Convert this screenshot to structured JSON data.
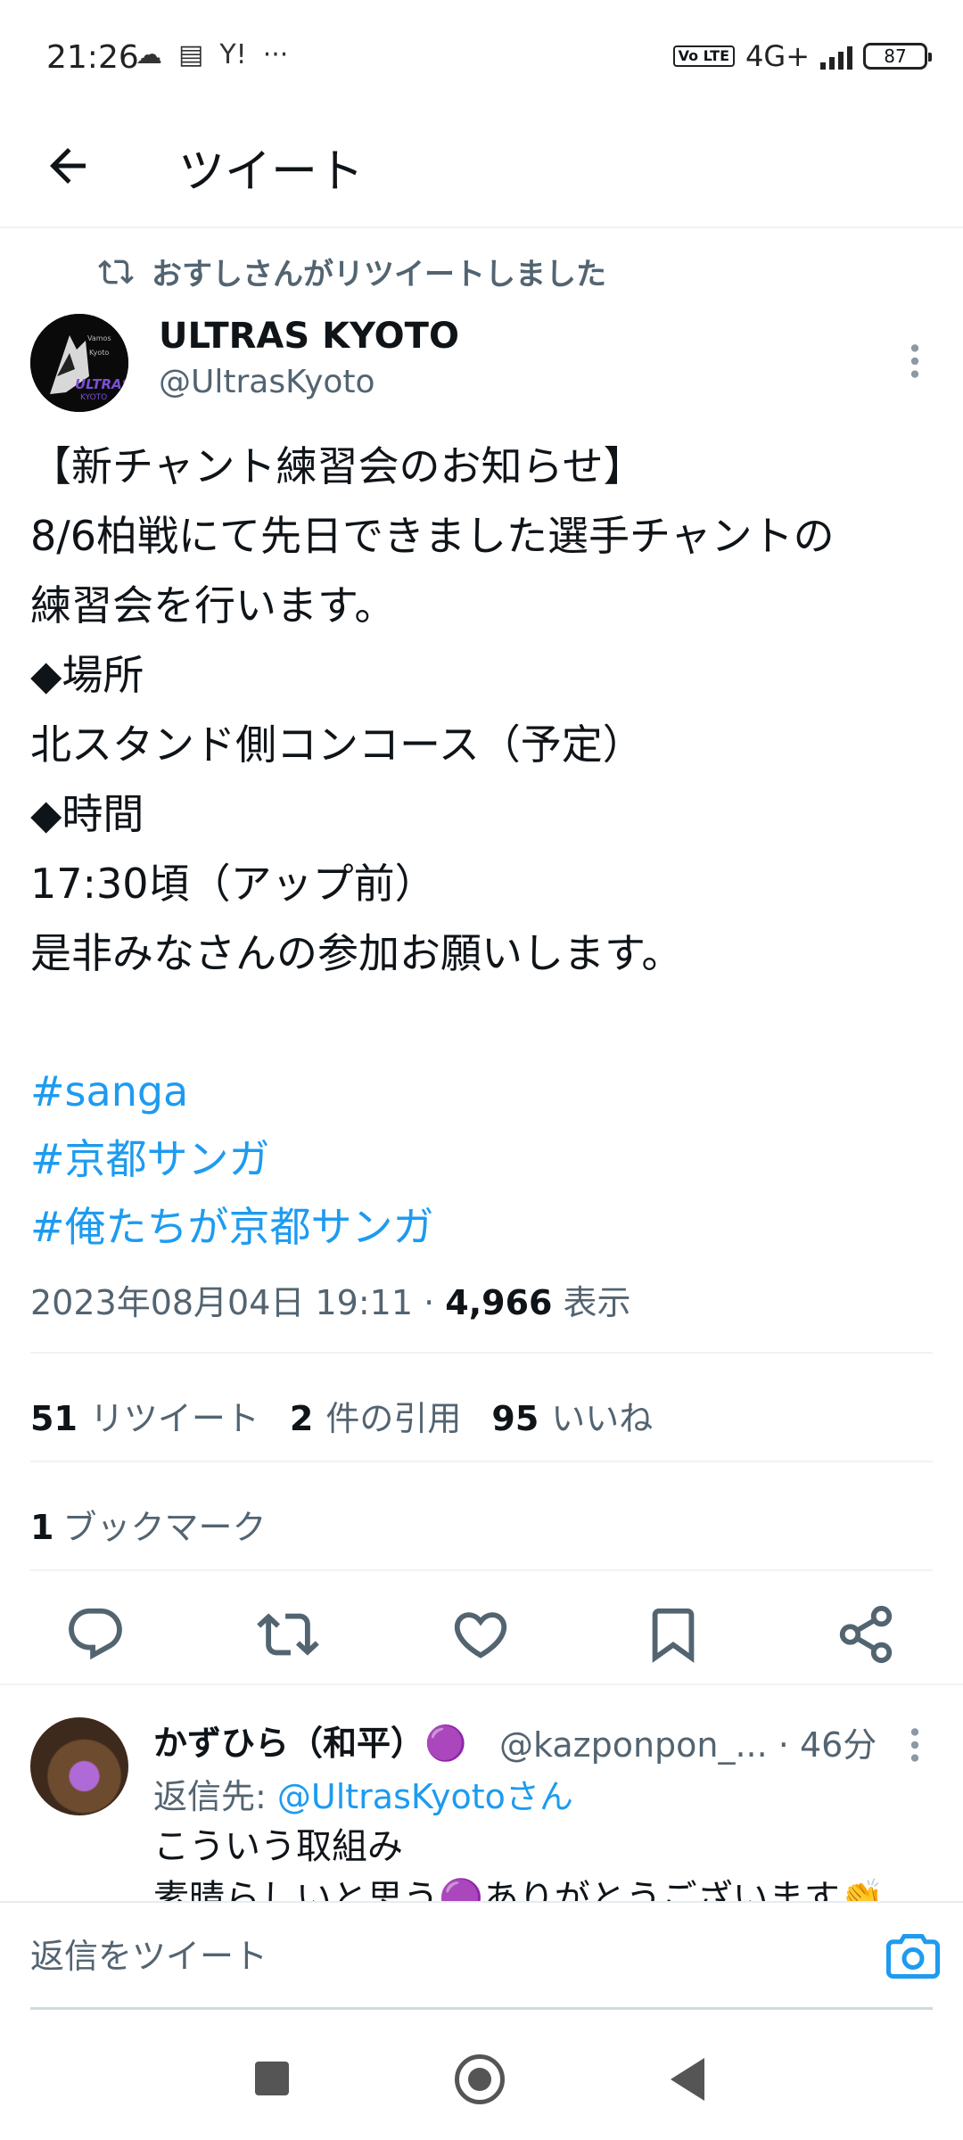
{
  "status_bar": {
    "time": "21:26",
    "icons": [
      "cloud-icon",
      "calendar-icon",
      "yahoo-icon",
      "more-dots-icon"
    ],
    "volte": "Vo LTE",
    "network": "4G+",
    "battery": "87"
  },
  "header": {
    "title": "ツイート"
  },
  "tweet": {
    "retweeted_by": "おすしさんがリツイートしました",
    "author_name": "ULTRAS KYOTO",
    "author_handle": "@UltrasKyoto",
    "avatar_text": "ULTRAS KYOTO",
    "lines": [
      "【新チャント練習会のお知らせ】",
      "8/6柏戦にて先日できました選手チャントの",
      "練習会を行います。",
      "◆場所",
      "北スタンド側コンコース（予定）",
      "◆時間",
      "17:30頃（アップ前）",
      "是非みなさんの参加お願いします。"
    ],
    "hashtags": [
      "#sanga",
      "#京都サンガ",
      "#俺たちが京都サンガ"
    ],
    "timestamp": "2023年08月04日 19:11 · ",
    "views_count": "4,966",
    "views_label": " 表示",
    "retweets_count": "51",
    "retweets_label": "リツイート",
    "quotes_count": "2",
    "quotes_label": "件の引用",
    "likes_count": "95",
    "likes_label": "いいね",
    "bookmarks_count": "1",
    "bookmarks_label": "ブックマーク"
  },
  "reply": {
    "name": "かずひら（和平）🟣",
    "handle": "@kazponpon_... · 46分",
    "reply_to_label": "返信先: ",
    "reply_to_handle": "@UltrasKyotoさん",
    "line1": "こういう取組み",
    "line2": "素晴らしいと思う🟣ありがとうございます👏"
  },
  "compose": {
    "placeholder": "返信をツイート"
  },
  "colors": {
    "accent": "#1d9bf0",
    "text": "#0f1419",
    "secondary": "#536471"
  }
}
